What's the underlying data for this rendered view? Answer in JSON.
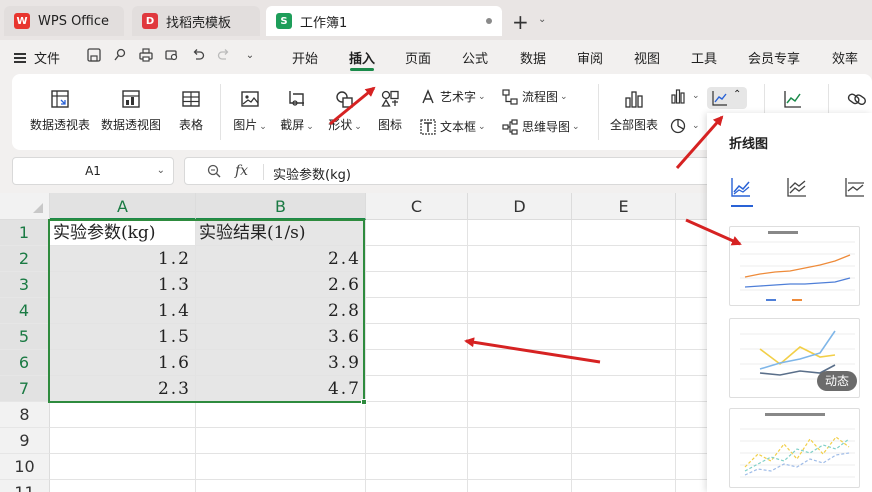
{
  "tabs": [
    {
      "label": "WPS Office",
      "icon": "wps-logo-icon"
    },
    {
      "label": "找稻壳模板",
      "icon": "docer-logo-icon"
    },
    {
      "label": "工作簿1",
      "icon": "sheet-logo-icon"
    }
  ],
  "menu": {
    "file": "文件",
    "items": [
      "开始",
      "插入",
      "页面",
      "公式",
      "数据",
      "审阅",
      "视图",
      "工具",
      "会员专享",
      "效率"
    ],
    "active": "插入"
  },
  "ribbon": {
    "pivot_table": "数据透视表",
    "pivot_chart": "数据透视图",
    "table": "表格",
    "picture": "图片",
    "screenshot": "截屏",
    "shape": "形状",
    "icon": "图标",
    "wordart": "艺术字",
    "textbox": "文本框",
    "flowchart": "流程图",
    "mindmap": "思维导图",
    "all_charts": "全部图表"
  },
  "formula_bar": {
    "cell_ref": "A1",
    "fx": "fx",
    "value": "实验参数(kg)"
  },
  "sheet": {
    "columns": [
      "A",
      "B",
      "C",
      "D",
      "E"
    ],
    "rows": [
      "1",
      "2",
      "3",
      "4",
      "5",
      "6",
      "7",
      "8",
      "9",
      "10",
      "11"
    ],
    "header": [
      "实验参数(kg)",
      "实验结果(1/s)"
    ],
    "data": [
      [
        "1.2",
        "2.4"
      ],
      [
        "1.3",
        "2.6"
      ],
      [
        "1.4",
        "2.8"
      ],
      [
        "1.5",
        "3.6"
      ],
      [
        "1.6",
        "3.9"
      ],
      [
        "2.3",
        "4.7"
      ]
    ]
  },
  "panel": {
    "title": "折线图",
    "badge": "动态"
  },
  "colors": {
    "accent": "#1a8a4a",
    "selection_border": "#2e8b3e",
    "arrow": "#d62222",
    "panel_tab": "#2962d6"
  }
}
